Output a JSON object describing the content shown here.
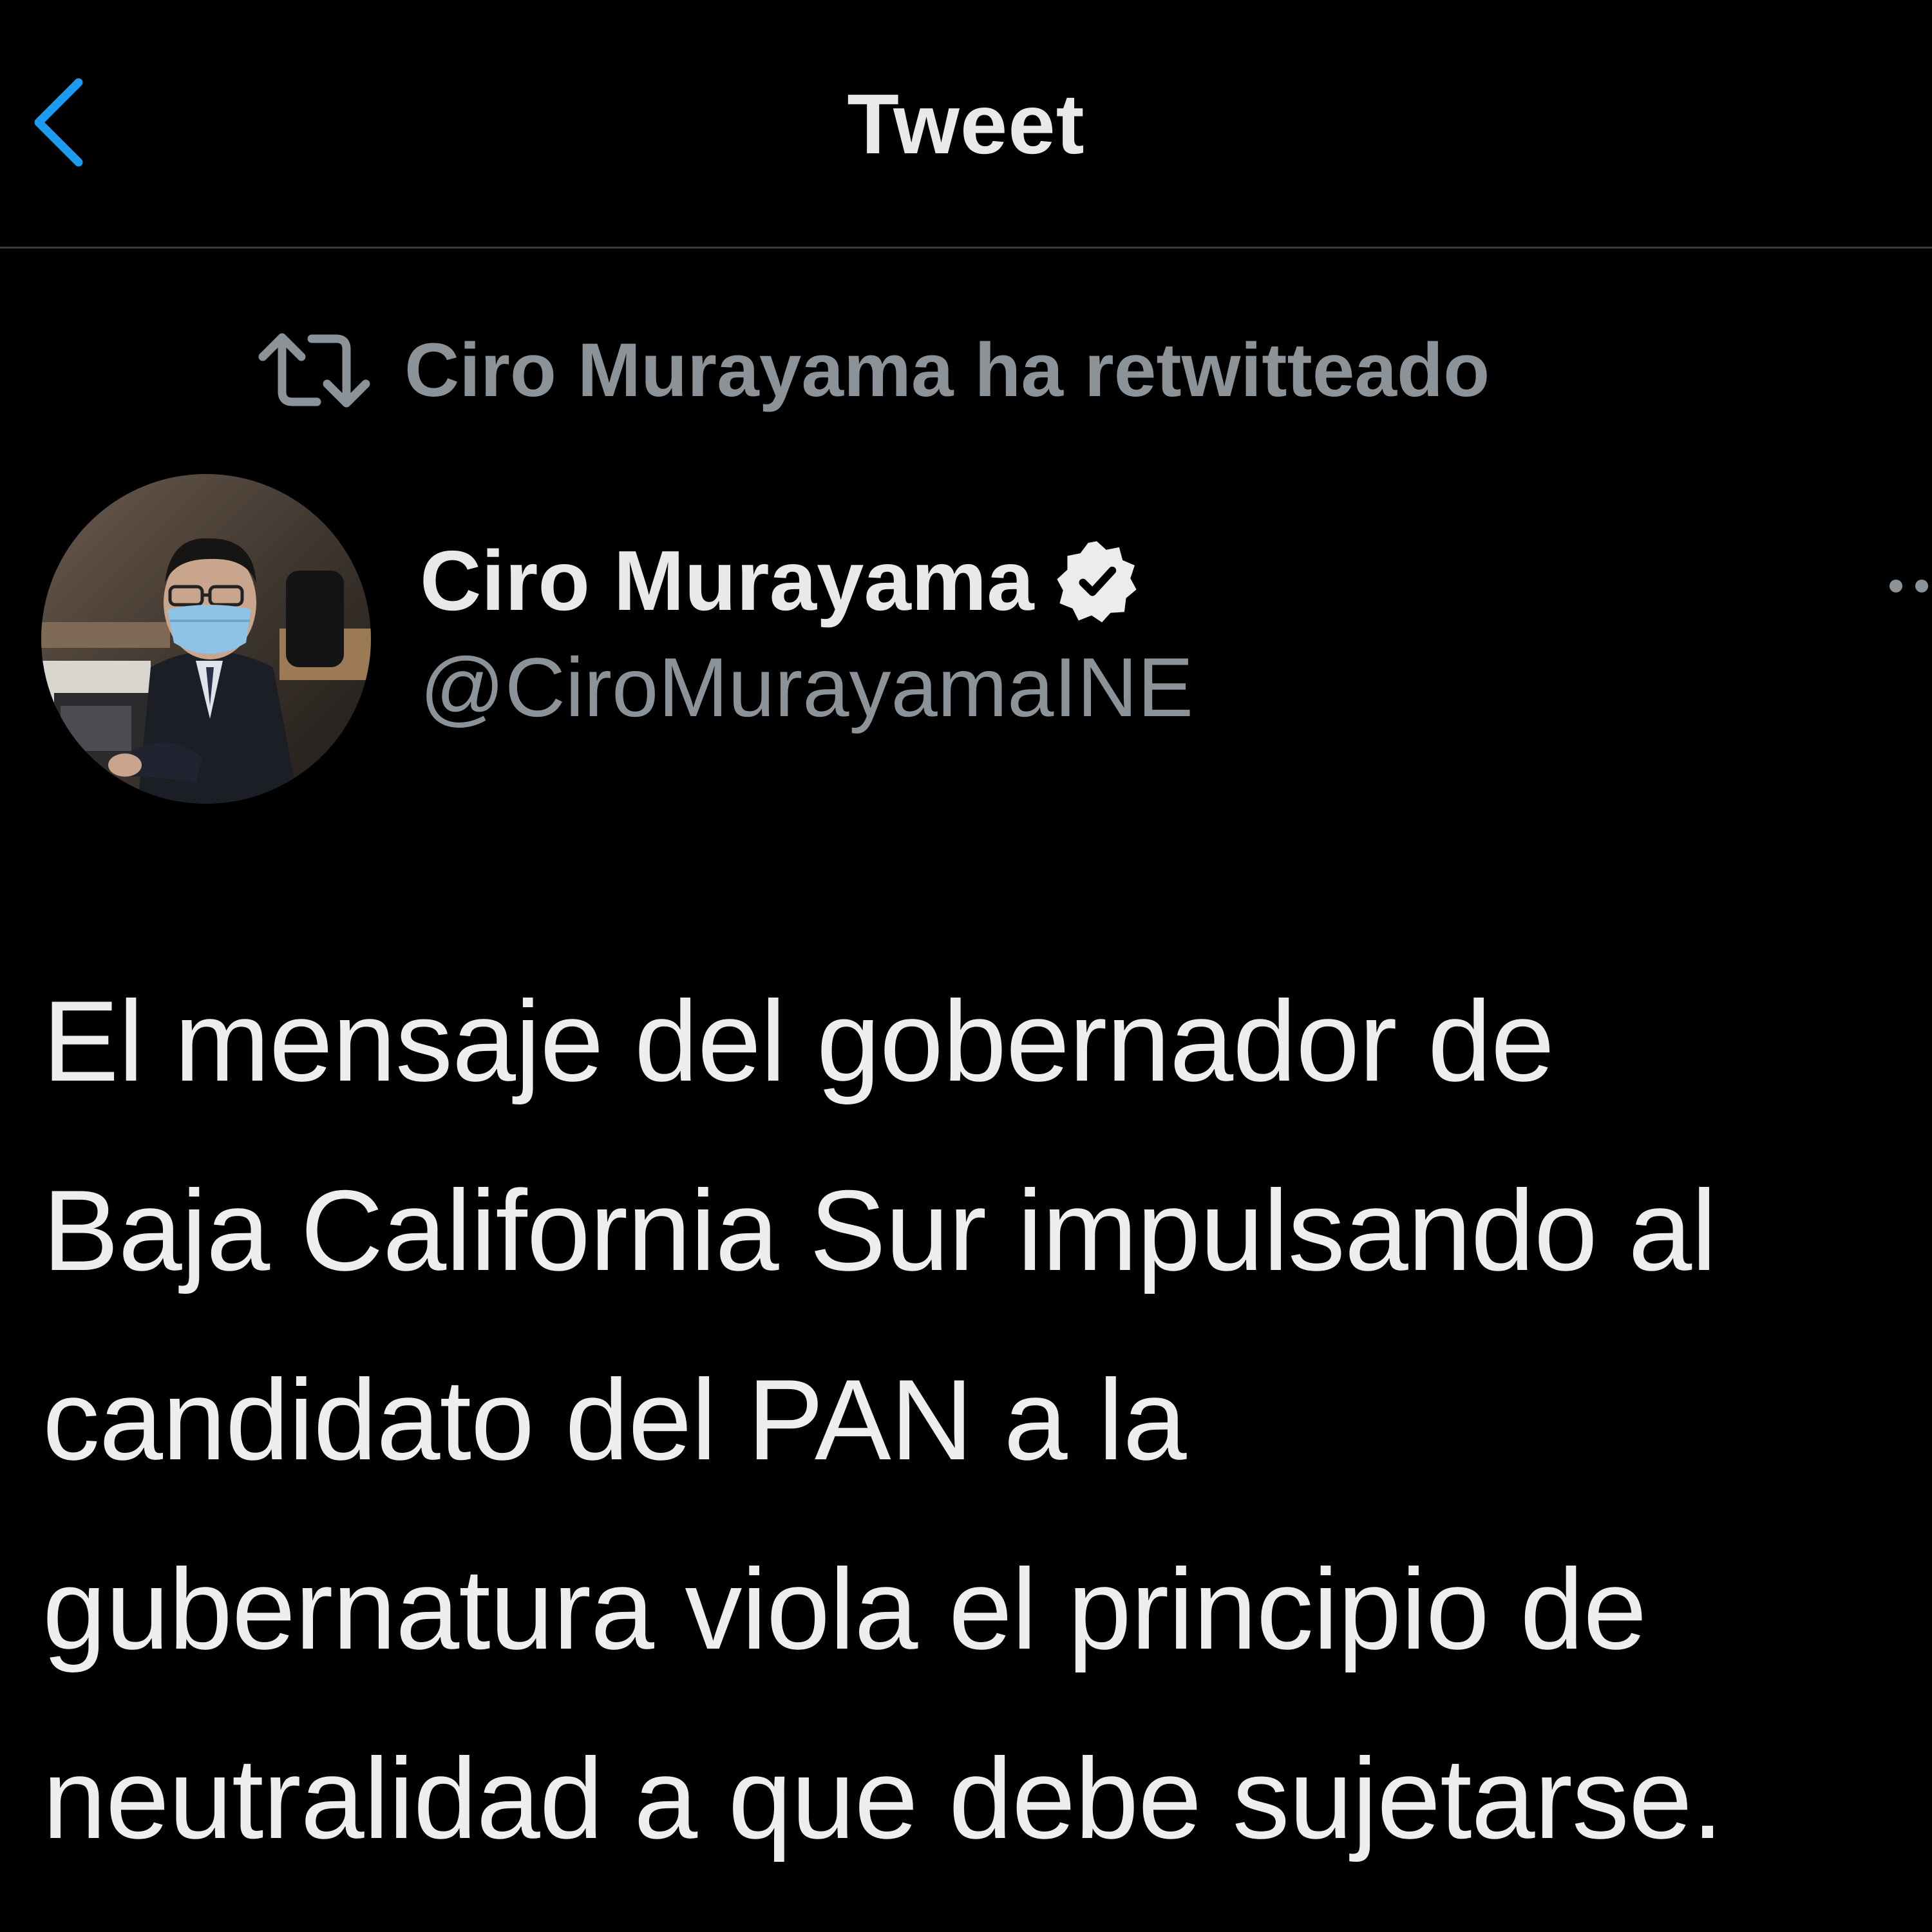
{
  "header": {
    "title": "Tweet",
    "back_icon": "chevron-left-icon"
  },
  "retweet_context": {
    "icon": "retweet-icon",
    "text": "Ciro Murayama ha retwitteado"
  },
  "author": {
    "display_name": "Ciro Murayama",
    "handle": "@CiroMurayamaINE",
    "verified": true,
    "avatar_icon": "avatar-photo"
  },
  "more_icon": "more-options-icon",
  "tweet": {
    "lines": [
      "El mensaje del gobernador de",
      "Baja California Sur impulsando al",
      "candidato del PAN a la",
      "gubernatura viola el principio de",
      "neutralidad a que debe sujetarse."
    ]
  },
  "colors": {
    "background": "#000000",
    "accent": "#1d9bf0",
    "primary_text": "#e7e9ea",
    "secondary_text": "#8b9298",
    "divider": "#3a3d40"
  }
}
